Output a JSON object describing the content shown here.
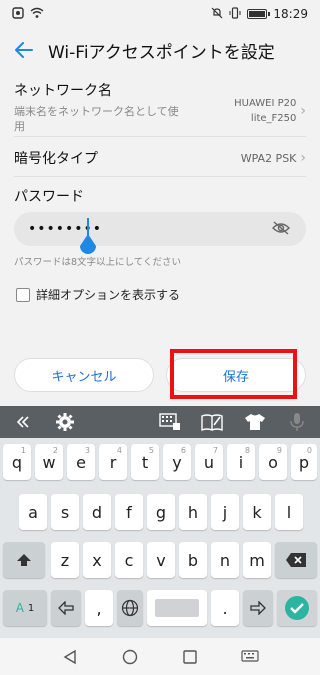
{
  "status_bar": {
    "time": "18:29"
  },
  "header": {
    "title": "Wi-Fiアクセスポイントを設定"
  },
  "network_name": {
    "label": "ネットワーク名",
    "description": "端末名をネットワーク名として使用",
    "value": "HUAWEI P20 lite_F250"
  },
  "encryption": {
    "label": "暗号化タイプ",
    "value": "WPA2 PSK"
  },
  "password": {
    "label": "パスワード",
    "value": "••••••••",
    "hint": "パスワードは8文字以上にしてください"
  },
  "advanced": {
    "label": "詳細オプションを表示する",
    "checked": false
  },
  "buttons": {
    "cancel": "キャンセル",
    "save": "保存"
  },
  "keyboard": {
    "row1": [
      {
        "k": "q",
        "h": "1"
      },
      {
        "k": "w",
        "h": "2"
      },
      {
        "k": "e",
        "h": "3"
      },
      {
        "k": "r",
        "h": "4"
      },
      {
        "k": "t",
        "h": "5"
      },
      {
        "k": "y",
        "h": "6"
      },
      {
        "k": "u",
        "h": "7"
      },
      {
        "k": "i",
        "h": "8"
      },
      {
        "k": "o",
        "h": "9"
      },
      {
        "k": "p",
        "h": "0"
      }
    ],
    "row2": [
      "a",
      "s",
      "d",
      "f",
      "g",
      "h",
      "j",
      "k",
      "l"
    ],
    "row3": [
      "z",
      "x",
      "c",
      "v",
      "b",
      "n",
      "m"
    ],
    "row4": {
      "mode": "A",
      "mode_num": "1",
      "comma": ",",
      "period": "."
    }
  },
  "colors": {
    "accent": "#1e88e5",
    "highlight": "#e11111",
    "ok_check": "#2bb5a0"
  }
}
